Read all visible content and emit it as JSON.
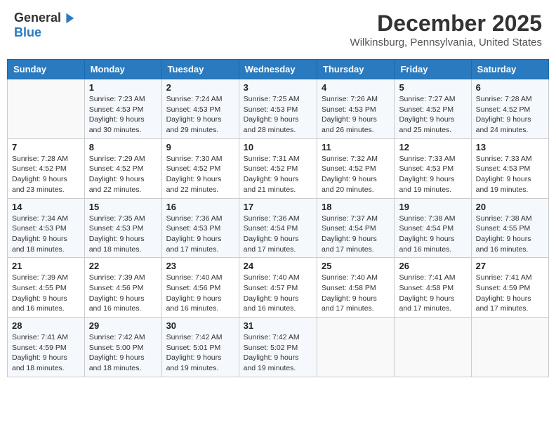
{
  "logo": {
    "general": "General",
    "blue": "Blue"
  },
  "title": {
    "month_year": "December 2025",
    "location": "Wilkinsburg, Pennsylvania, United States"
  },
  "days_of_week": [
    "Sunday",
    "Monday",
    "Tuesday",
    "Wednesday",
    "Thursday",
    "Friday",
    "Saturday"
  ],
  "weeks": [
    [
      {
        "day": "",
        "info": ""
      },
      {
        "day": "1",
        "info": "Sunrise: 7:23 AM\nSunset: 4:53 PM\nDaylight: 9 hours\nand 30 minutes."
      },
      {
        "day": "2",
        "info": "Sunrise: 7:24 AM\nSunset: 4:53 PM\nDaylight: 9 hours\nand 29 minutes."
      },
      {
        "day": "3",
        "info": "Sunrise: 7:25 AM\nSunset: 4:53 PM\nDaylight: 9 hours\nand 28 minutes."
      },
      {
        "day": "4",
        "info": "Sunrise: 7:26 AM\nSunset: 4:53 PM\nDaylight: 9 hours\nand 26 minutes."
      },
      {
        "day": "5",
        "info": "Sunrise: 7:27 AM\nSunset: 4:52 PM\nDaylight: 9 hours\nand 25 minutes."
      },
      {
        "day": "6",
        "info": "Sunrise: 7:28 AM\nSunset: 4:52 PM\nDaylight: 9 hours\nand 24 minutes."
      }
    ],
    [
      {
        "day": "7",
        "info": "Sunrise: 7:28 AM\nSunset: 4:52 PM\nDaylight: 9 hours\nand 23 minutes."
      },
      {
        "day": "8",
        "info": "Sunrise: 7:29 AM\nSunset: 4:52 PM\nDaylight: 9 hours\nand 22 minutes."
      },
      {
        "day": "9",
        "info": "Sunrise: 7:30 AM\nSunset: 4:52 PM\nDaylight: 9 hours\nand 22 minutes."
      },
      {
        "day": "10",
        "info": "Sunrise: 7:31 AM\nSunset: 4:52 PM\nDaylight: 9 hours\nand 21 minutes."
      },
      {
        "day": "11",
        "info": "Sunrise: 7:32 AM\nSunset: 4:52 PM\nDaylight: 9 hours\nand 20 minutes."
      },
      {
        "day": "12",
        "info": "Sunrise: 7:33 AM\nSunset: 4:53 PM\nDaylight: 9 hours\nand 19 minutes."
      },
      {
        "day": "13",
        "info": "Sunrise: 7:33 AM\nSunset: 4:53 PM\nDaylight: 9 hours\nand 19 minutes."
      }
    ],
    [
      {
        "day": "14",
        "info": "Sunrise: 7:34 AM\nSunset: 4:53 PM\nDaylight: 9 hours\nand 18 minutes."
      },
      {
        "day": "15",
        "info": "Sunrise: 7:35 AM\nSunset: 4:53 PM\nDaylight: 9 hours\nand 18 minutes."
      },
      {
        "day": "16",
        "info": "Sunrise: 7:36 AM\nSunset: 4:53 PM\nDaylight: 9 hours\nand 17 minutes."
      },
      {
        "day": "17",
        "info": "Sunrise: 7:36 AM\nSunset: 4:54 PM\nDaylight: 9 hours\nand 17 minutes."
      },
      {
        "day": "18",
        "info": "Sunrise: 7:37 AM\nSunset: 4:54 PM\nDaylight: 9 hours\nand 17 minutes."
      },
      {
        "day": "19",
        "info": "Sunrise: 7:38 AM\nSunset: 4:54 PM\nDaylight: 9 hours\nand 16 minutes."
      },
      {
        "day": "20",
        "info": "Sunrise: 7:38 AM\nSunset: 4:55 PM\nDaylight: 9 hours\nand 16 minutes."
      }
    ],
    [
      {
        "day": "21",
        "info": "Sunrise: 7:39 AM\nSunset: 4:55 PM\nDaylight: 9 hours\nand 16 minutes."
      },
      {
        "day": "22",
        "info": "Sunrise: 7:39 AM\nSunset: 4:56 PM\nDaylight: 9 hours\nand 16 minutes."
      },
      {
        "day": "23",
        "info": "Sunrise: 7:40 AM\nSunset: 4:56 PM\nDaylight: 9 hours\nand 16 minutes."
      },
      {
        "day": "24",
        "info": "Sunrise: 7:40 AM\nSunset: 4:57 PM\nDaylight: 9 hours\nand 16 minutes."
      },
      {
        "day": "25",
        "info": "Sunrise: 7:40 AM\nSunset: 4:58 PM\nDaylight: 9 hours\nand 17 minutes."
      },
      {
        "day": "26",
        "info": "Sunrise: 7:41 AM\nSunset: 4:58 PM\nDaylight: 9 hours\nand 17 minutes."
      },
      {
        "day": "27",
        "info": "Sunrise: 7:41 AM\nSunset: 4:59 PM\nDaylight: 9 hours\nand 17 minutes."
      }
    ],
    [
      {
        "day": "28",
        "info": "Sunrise: 7:41 AM\nSunset: 4:59 PM\nDaylight: 9 hours\nand 18 minutes."
      },
      {
        "day": "29",
        "info": "Sunrise: 7:42 AM\nSunset: 5:00 PM\nDaylight: 9 hours\nand 18 minutes."
      },
      {
        "day": "30",
        "info": "Sunrise: 7:42 AM\nSunset: 5:01 PM\nDaylight: 9 hours\nand 19 minutes."
      },
      {
        "day": "31",
        "info": "Sunrise: 7:42 AM\nSunset: 5:02 PM\nDaylight: 9 hours\nand 19 minutes."
      },
      {
        "day": "",
        "info": ""
      },
      {
        "day": "",
        "info": ""
      },
      {
        "day": "",
        "info": ""
      }
    ]
  ]
}
